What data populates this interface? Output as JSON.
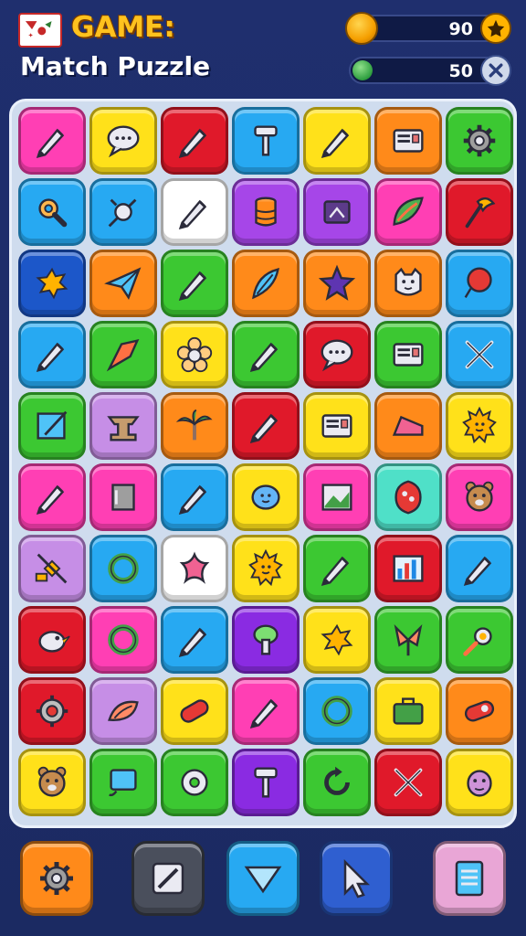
{
  "header": {
    "title_line1": "GAME:",
    "title_line2": "Match Puzzle",
    "logo_icon": "game-logo-icon"
  },
  "stats": {
    "coins": {
      "value": "90",
      "icon": "coin-icon",
      "action_icon": "star-badge-icon"
    },
    "gems": {
      "value": "50",
      "icon": "gem-icon",
      "action_icon": "close-x-icon"
    }
  },
  "board": {
    "rows": 10,
    "cols": 7,
    "tiles": [
      {
        "color": "#ff3fb4",
        "icon": "pencil-icon"
      },
      {
        "color": "#ffe11a",
        "icon": "chat-bubble-icon"
      },
      {
        "color": "#e0192a",
        "icon": "pencil-icon"
      },
      {
        "color": "#27a9f2",
        "icon": "hammer-icon"
      },
      {
        "color": "#ffe11a",
        "icon": "pencil-icon"
      },
      {
        "color": "#ff8a1a",
        "icon": "panel-icon"
      },
      {
        "color": "#3cc832",
        "icon": "gear-icon"
      },
      {
        "color": "#27a9f2",
        "icon": "wrench-icon"
      },
      {
        "color": "#27a9f2",
        "icon": "node-icon"
      },
      {
        "color": "#ffffff",
        "icon": "pencil-icon"
      },
      {
        "color": "#a646e8",
        "icon": "barrel-icon"
      },
      {
        "color": "#a646e8",
        "icon": "frame-icon"
      },
      {
        "color": "#ff3fb4",
        "icon": "leaf-icon"
      },
      {
        "color": "#e0192a",
        "icon": "axe-icon"
      },
      {
        "color": "#1c57c9",
        "icon": "splat-icon"
      },
      {
        "color": "#ff8a1a",
        "icon": "paper-plane-icon"
      },
      {
        "color": "#3cc832",
        "icon": "pencil-icon"
      },
      {
        "color": "#ff8a1a",
        "icon": "feather-icon"
      },
      {
        "color": "#ff8a1a",
        "icon": "star-icon"
      },
      {
        "color": "#ff8a1a",
        "icon": "cat-icon"
      },
      {
        "color": "#27a9f2",
        "icon": "balloon-icon"
      },
      {
        "color": "#27a9f2",
        "icon": "pencil-icon"
      },
      {
        "color": "#3cc832",
        "icon": "arrowhead-icon"
      },
      {
        "color": "#ffe11a",
        "icon": "flower-icon"
      },
      {
        "color": "#3cc832",
        "icon": "pencil-icon"
      },
      {
        "color": "#e0192a",
        "icon": "chat-bubble-icon"
      },
      {
        "color": "#3cc832",
        "icon": "panel-icon"
      },
      {
        "color": "#27a9f2",
        "icon": "swords-icon"
      },
      {
        "color": "#3cc832",
        "icon": "picture-edit-icon"
      },
      {
        "color": "#c68ee6",
        "icon": "anvil-icon"
      },
      {
        "color": "#ff8a1a",
        "icon": "palm-icon"
      },
      {
        "color": "#e0192a",
        "icon": "pencil-icon"
      },
      {
        "color": "#ffe11a",
        "icon": "panel-icon"
      },
      {
        "color": "#ff8a1a",
        "icon": "cheese-icon"
      },
      {
        "color": "#ffe11a",
        "icon": "sun-face-icon"
      },
      {
        "color": "#ff3fb4",
        "icon": "pencil-icon"
      },
      {
        "color": "#ff3fb4",
        "icon": "canister-icon"
      },
      {
        "color": "#27a9f2",
        "icon": "pencil-icon"
      },
      {
        "color": "#ffe11a",
        "icon": "blob-face-icon"
      },
      {
        "color": "#ff3fb4",
        "icon": "picture-icon"
      },
      {
        "color": "#4fe0c8",
        "icon": "shield-icon"
      },
      {
        "color": "#ff3fb4",
        "icon": "bear-icon"
      },
      {
        "color": "#c68ee6",
        "icon": "satellite-icon"
      },
      {
        "color": "#27a9f2",
        "icon": "ring-icon"
      },
      {
        "color": "#ffffff",
        "icon": "starfish-icon"
      },
      {
        "color": "#ffe11a",
        "icon": "sun-face-icon"
      },
      {
        "color": "#3cc832",
        "icon": "pencil-icon"
      },
      {
        "color": "#e0192a",
        "icon": "bar-chart-icon"
      },
      {
        "color": "#27a9f2",
        "icon": "pencil-icon"
      },
      {
        "color": "#e0192a",
        "icon": "bird-icon"
      },
      {
        "color": "#ff3fb4",
        "icon": "ring-icon"
      },
      {
        "color": "#27a9f2",
        "icon": "pencil-icon"
      },
      {
        "color": "#8a2be2",
        "icon": "mushroom-icon"
      },
      {
        "color": "#ffe11a",
        "icon": "splat-icon"
      },
      {
        "color": "#3cc832",
        "icon": "bow-icon"
      },
      {
        "color": "#3cc832",
        "icon": "orb-icon"
      },
      {
        "color": "#e0192a",
        "icon": "cog-eye-icon"
      },
      {
        "color": "#c68ee6",
        "icon": "shell-icon"
      },
      {
        "color": "#ffe11a",
        "icon": "pill-icon"
      },
      {
        "color": "#ff3fb4",
        "icon": "pencil-icon"
      },
      {
        "color": "#27a9f2",
        "icon": "ring-icon"
      },
      {
        "color": "#ffe11a",
        "icon": "briefcase-icon"
      },
      {
        "color": "#ff8a1a",
        "icon": "capsule-icon"
      },
      {
        "color": "#ffe11a",
        "icon": "bear-icon"
      },
      {
        "color": "#3cc832",
        "icon": "monitor-icon"
      },
      {
        "color": "#3cc832",
        "icon": "donut-icon"
      },
      {
        "color": "#8a2be2",
        "icon": "hammer-icon"
      },
      {
        "color": "#3cc832",
        "icon": "refresh-icon"
      },
      {
        "color": "#e0192a",
        "icon": "swords-icon"
      },
      {
        "color": "#ffe11a",
        "icon": "face-icon"
      }
    ]
  },
  "toolbar": [
    {
      "name": "settings-button",
      "color": "#ff8a1a",
      "icon": "gear-icon"
    },
    {
      "name": "edit-button",
      "color": "#4a4f5c",
      "icon": "edit-icon"
    },
    {
      "name": "hint-button",
      "color": "#27a9f2",
      "icon": "arrow-down-icon"
    },
    {
      "name": "pointer-button",
      "color": "#2f5fd0",
      "icon": "cursor-icon"
    },
    {
      "name": "notes-button",
      "color": "#e9a6d6",
      "icon": "document-icon"
    }
  ]
}
